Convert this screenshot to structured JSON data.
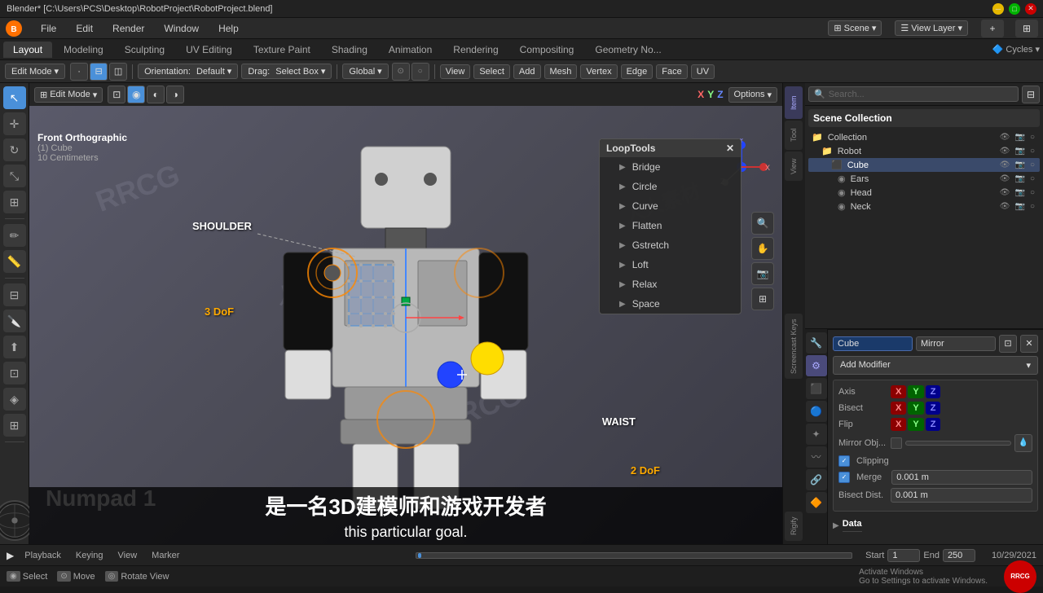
{
  "window": {
    "title": "Blender* [C:\\Users\\PCS\\Desktop\\RobotProject\\RobotProject.blend]",
    "controls": [
      "minimize",
      "maximize",
      "close"
    ]
  },
  "menubar": {
    "items": [
      "File",
      "Edit",
      "Render",
      "Window",
      "Help"
    ]
  },
  "workspace_tabs": {
    "items": [
      "Layout",
      "Modeling",
      "Sculpting",
      "UV Editing",
      "Texture Paint",
      "Shading",
      "Animation",
      "Rendering",
      "Compositing",
      "Geometry No..."
    ],
    "active": "Layout"
  },
  "scene_selector": {
    "label": "Scene"
  },
  "view_layer_selector": {
    "label": "View Layer"
  },
  "toolbar": {
    "mode": "Edit Mode",
    "orientation": "Default",
    "drag": "Select Box",
    "transform": "Global",
    "buttons": [
      "View",
      "Select",
      "Add",
      "Mesh",
      "Vertex",
      "Edge",
      "Face",
      "UV"
    ]
  },
  "viewport": {
    "mode": "Front Orthographic",
    "object": "(1) Cube",
    "scale": "10 Centimeters",
    "numpad": "Numpad 1"
  },
  "looptools": {
    "title": "LoopTools",
    "items": [
      "Bridge",
      "Circle",
      "Curve",
      "Flatten",
      "Gstretch",
      "Loft",
      "Relax",
      "Space"
    ]
  },
  "labels_3d": {
    "shoulder": "SHOULDER",
    "waist": "WAIST",
    "dof_3": "3 DoF",
    "dof_2": "2 DoF"
  },
  "scene_collection": {
    "title": "Scene Collection",
    "items": [
      {
        "name": "Collection",
        "level": 0,
        "icon": "▸"
      },
      {
        "name": "Robot",
        "level": 1,
        "icon": "▸"
      },
      {
        "name": "Cube",
        "level": 2,
        "icon": "▪",
        "active": true
      },
      {
        "name": "Ears",
        "level": 3,
        "icon": "◉"
      },
      {
        "name": "Head",
        "level": 3,
        "icon": "◉"
      },
      {
        "name": "Neck",
        "level": 3,
        "icon": "◉"
      }
    ]
  },
  "properties": {
    "object_name": "Cube",
    "modifier_name": "Mirror",
    "add_modifier_label": "Add Modifier",
    "axis_label": "Axis",
    "bisect_label": "Bisect",
    "flip_label": "Flip",
    "mirror_obj_label": "Mirror Obj...",
    "clipping_label": "Clipping",
    "merge_label": "Merge",
    "merge_value": "0.001 m",
    "bisect_dist_label": "Bisect Dist.",
    "bisect_dist_value": "0.001 m",
    "data_label": "Data",
    "x_btn": "X",
    "y_btn": "Y",
    "z_btn": "Z"
  },
  "timeline": {
    "playback_label": "Playback",
    "keying_label": "Keying",
    "view_label": "View",
    "marker_label": "Marker",
    "start_label": "Start",
    "start_value": "1",
    "end_label": "End",
    "end_value": "250"
  },
  "statusbar": {
    "select_label": "Select",
    "move_label": "Move",
    "rotate_label": "Rotate View",
    "datetime": "10/29/2021"
  },
  "subtitle": {
    "cn": "是一名3D建模师和游戏开发者",
    "en": "this particular goal."
  },
  "colors": {
    "accent_blue": "#4a90d9",
    "accent_orange": "#ff8800",
    "active_green": "#00b300",
    "bg_dark": "#1e1e1e",
    "bg_mid": "#2a2a2a",
    "bg_light": "#3a3a3a"
  }
}
